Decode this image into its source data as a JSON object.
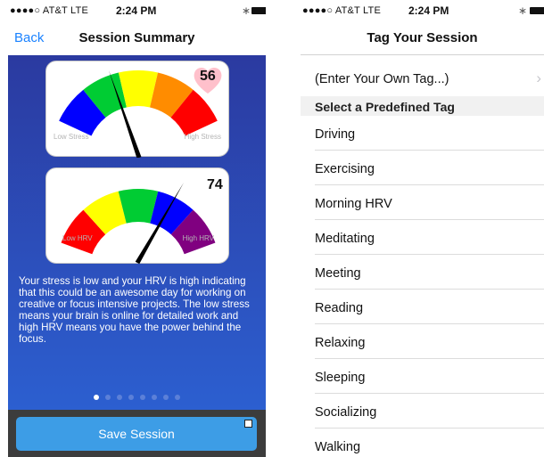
{
  "status_bar": {
    "carrier": "●●●●○ AT&T  LTE",
    "time": "2:24 PM",
    "bluetooth": "bluetooth-icon",
    "battery": "battery-icon"
  },
  "summary_screen": {
    "back_label": "Back",
    "title": "Session Summary",
    "stress_gauge": {
      "value": "56",
      "low_label": "Low Stress",
      "high_label": "High Stress",
      "colors": [
        "#0000ff",
        "#00cc33",
        "#ffff00",
        "#ff8c00",
        "#ff0000"
      ],
      "badge_color": "#ffc0cb"
    },
    "hrv_gauge": {
      "value": "74",
      "low_label": "Low HRV",
      "high_label": "High HRV",
      "colors": [
        "#ff0000",
        "#ffff00",
        "#00cc33",
        "#0000ff",
        "#800080"
      ]
    },
    "description": "Your stress is low and your HRV is high indicating that this could be an awesome day for working on creative or focus intensive projects. The low stress means your brain is online for detailed work and high HRV means you have the power behind the focus.",
    "page_count": 8,
    "current_page": 1,
    "save_label": "Save Session",
    "save_button_color": "#3d9de6"
  },
  "tag_screen": {
    "title": "Tag Your Session",
    "custom_tag_label": "(Enter Your Own Tag...)",
    "section_header": "Select a Predefined Tag",
    "tags": [
      "Driving",
      "Exercising",
      "Morning HRV",
      "Meditating",
      "Meeting",
      "Reading",
      "Relaxing",
      "Sleeping",
      "Socializing",
      "Walking"
    ]
  }
}
